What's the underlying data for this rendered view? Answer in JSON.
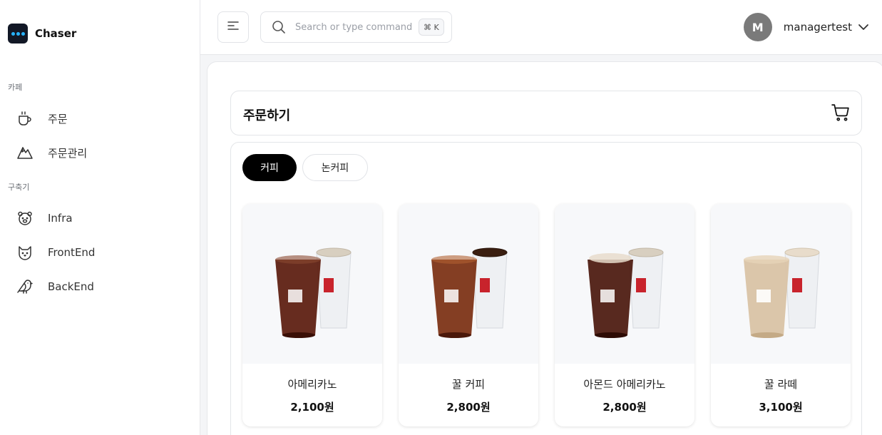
{
  "brand": {
    "name": "Chaser"
  },
  "sidebar": {
    "sections": [
      {
        "label": "카페"
      },
      {
        "label": "구축기"
      }
    ],
    "items": [
      {
        "label": "주문",
        "icon": "coffee-cup-icon"
      },
      {
        "label": "주문관리",
        "icon": "mountain-icon"
      },
      {
        "label": "Infra",
        "icon": "bear-icon"
      },
      {
        "label": "FrontEnd",
        "icon": "cat-icon"
      },
      {
        "label": "BackEnd",
        "icon": "bird-icon"
      }
    ]
  },
  "header": {
    "search": {
      "placeholder": "Search or type command...",
      "shortcut": "⌘ K"
    },
    "user": {
      "initial": "M",
      "name": "managertest"
    }
  },
  "main": {
    "title": "주문하기",
    "tabs": [
      {
        "label": "커피",
        "active": true
      },
      {
        "label": "논커피",
        "active": false
      }
    ],
    "products": [
      {
        "name": "아메리카노",
        "price": "2,100원",
        "drink_color": "#5a1a0c",
        "hot_color": "#d8cfc0"
      },
      {
        "name": "꿀 커피",
        "price": "2,800원",
        "drink_color": "#7a2e10",
        "hot_color": "#3a1e10"
      },
      {
        "name": "아몬드 아메리카노",
        "price": "2,800원",
        "drink_color": "#4a170c",
        "hot_color": "#d8cfc0"
      },
      {
        "name": "꿀 라떼",
        "price": "3,100원",
        "drink_color": "#d9c3a5",
        "hot_color": "#e8dccb"
      }
    ]
  },
  "colors": {
    "accent": "#000000",
    "brand_dot": "#27b3ff",
    "cup_logo": "#c8232c"
  }
}
